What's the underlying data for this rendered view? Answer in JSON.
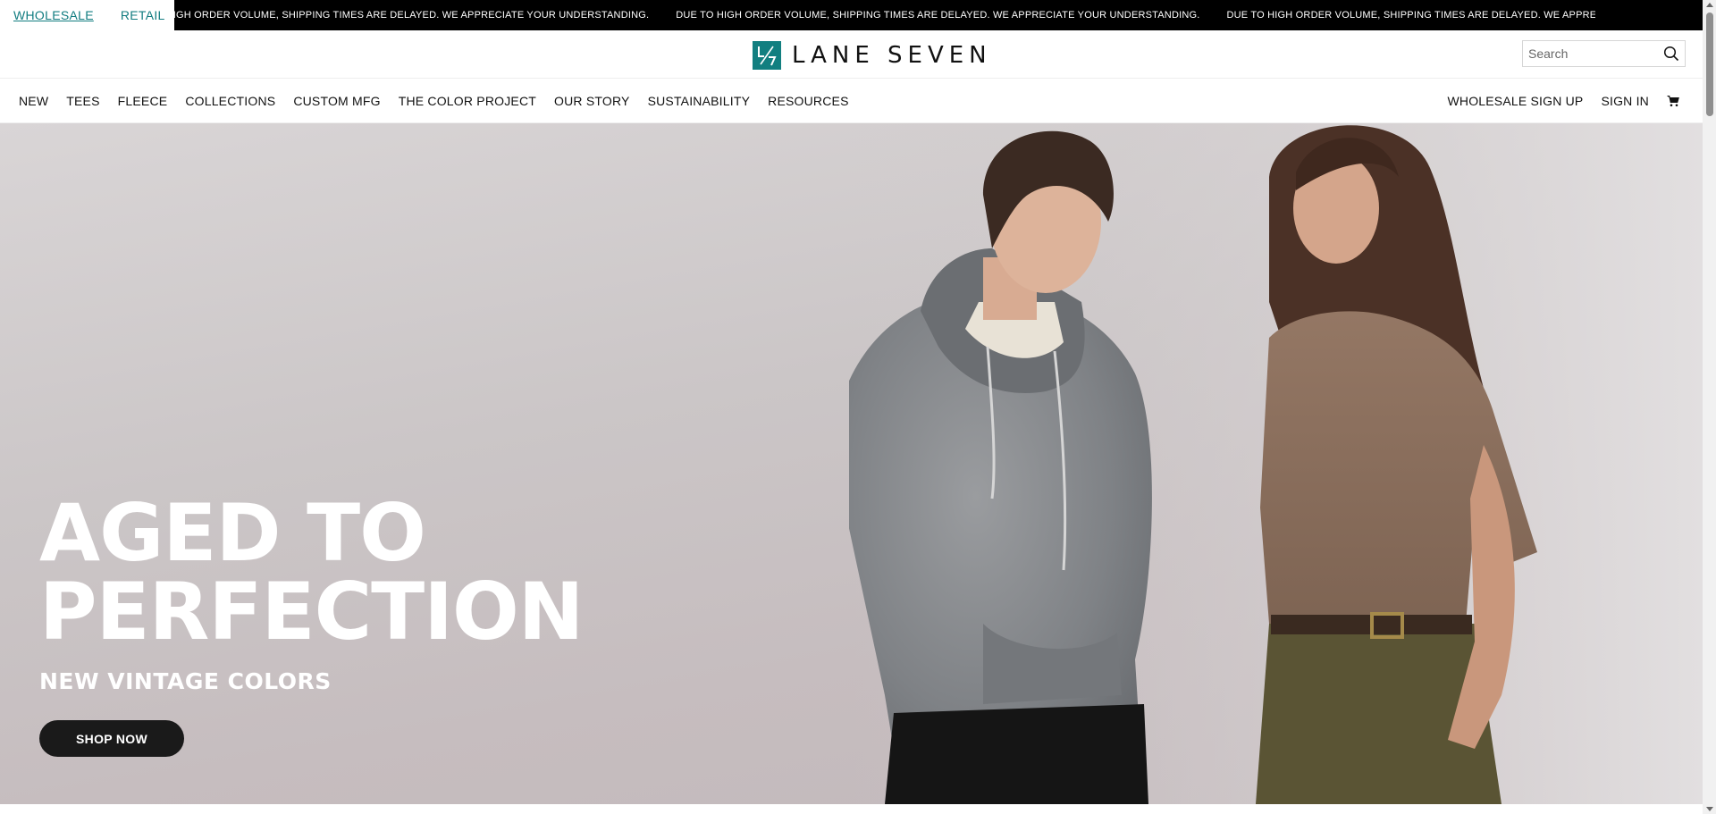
{
  "store_switch": {
    "wholesale": "WHOLESALE",
    "retail": "RETAIL"
  },
  "announcement": {
    "segments": [
      "DUE TO HIGH ORDER VOLUME, SHIPPING TIMES ARE DELAYED. WE APPRECIATE YOUR UNDERSTANDING.",
      "DUE TO HIGH ORDER VOLUME, SHIPPING TIMES ARE DELAYED. WE APPRECIATE YOUR UNDERSTANDING.",
      "DUE TO HIGH ORDER VOLUME, SHIPPING TIMES ARE DELAYED. WE APPRECIATE YOUR UNDERSTANDING."
    ]
  },
  "header": {
    "logo_text": "LANE SEVEN",
    "search_placeholder": "Search"
  },
  "nav": {
    "left": [
      "NEW",
      "TEES",
      "FLEECE",
      "COLLECTIONS",
      "CUSTOM MFG",
      "THE COLOR PROJECT",
      "OUR STORY",
      "SUSTAINABILITY",
      "RESOURCES"
    ],
    "wholesale_signup": "WHOLESALE SIGN UP",
    "sign_in": "SIGN IN",
    "cart_icon": "cart-icon"
  },
  "hero": {
    "title_line1": "AGED TO",
    "title_line2": "PERFECTION",
    "subtitle": "NEW VINTAGE COLORS",
    "button": "SHOP NOW"
  },
  "colors": {
    "brand_teal": "#127f80",
    "top_bar": "#000000",
    "button_dark": "#1a1a1a"
  }
}
